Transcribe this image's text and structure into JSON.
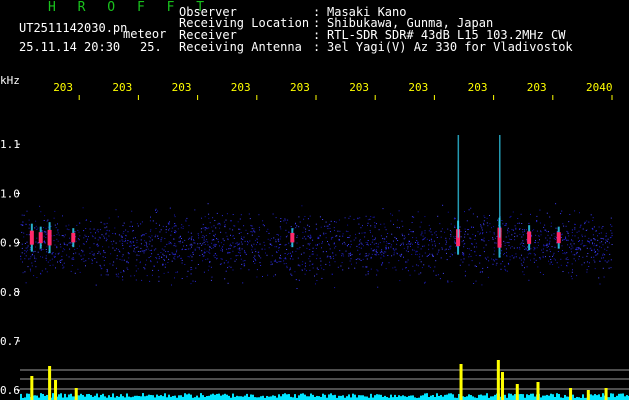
{
  "header": {
    "brand": "H R O F F T",
    "filename": "UT2511142030.pn",
    "tag": "meteor",
    "datetime": "25.11.14 20:30",
    "count": "25.",
    "colon": ":",
    "fields": [
      {
        "label": "Observer",
        "value": "Masaki Kano"
      },
      {
        "label": "Receiving Location",
        "value": "Shibukawa, Gunma, Japan"
      },
      {
        "label": "Receiver",
        "value": "RTL-SDR SDR# 43dB L15 103.2MHz CW"
      },
      {
        "label": "Receiving Antenna",
        "value": "3el Yagi(V) Az 330 for Vladivostok"
      }
    ]
  },
  "chart_data": {
    "type": "heatmap",
    "ylabel": "kHz",
    "y_ticks": [
      "1.1",
      "1.0",
      "0.9",
      "0.8",
      "0.7",
      "0.6"
    ],
    "y_tick_values": [
      1.1,
      1.0,
      0.9,
      0.8,
      0.7,
      0.6
    ],
    "x_ticks": [
      "203",
      "203",
      "203",
      "203",
      "203",
      "203",
      "203",
      "203",
      "203",
      "2040"
    ],
    "xlim": [
      2030,
      2040
    ],
    "ylim": [
      0.58,
      1.2
    ],
    "noise_band_khz": [
      0.8,
      0.99
    ],
    "colors": {
      "text": "#ffffff",
      "ticks": "#ffff00",
      "brand": "#19c21d",
      "noise": "#2a2ad8",
      "echo_core": "#ff2a6a",
      "echo_edge": "#33ddff",
      "level": "#ffff00",
      "floor": "#00e5ff"
    },
    "echoes": [
      {
        "x": 2030.2,
        "intensity": 0.6
      },
      {
        "x": 2030.35,
        "intensity": 0.4
      },
      {
        "x": 2030.5,
        "intensity": 0.7
      },
      {
        "x": 2030.9,
        "intensity": 0.3
      },
      {
        "x": 2034.6,
        "intensity": 0.3
      },
      {
        "x": 2037.4,
        "intensity": 0.8
      },
      {
        "x": 2038.1,
        "intensity": 1.0
      },
      {
        "x": 2038.6,
        "intensity": 0.5
      },
      {
        "x": 2039.1,
        "intensity": 0.4
      }
    ],
    "level_spikes": [
      {
        "x": 2030.2,
        "value": 0.6
      },
      {
        "x": 2030.5,
        "value": 0.85
      },
      {
        "x": 2030.6,
        "value": 0.5
      },
      {
        "x": 2030.95,
        "value": 0.3
      },
      {
        "x": 2037.45,
        "value": 0.9
      },
      {
        "x": 2038.08,
        "value": 1.0
      },
      {
        "x": 2038.15,
        "value": 0.7
      },
      {
        "x": 2038.4,
        "value": 0.4
      },
      {
        "x": 2038.75,
        "value": 0.45
      },
      {
        "x": 2039.3,
        "value": 0.3
      },
      {
        "x": 2039.6,
        "value": 0.25
      },
      {
        "x": 2039.9,
        "value": 0.3
      }
    ]
  }
}
